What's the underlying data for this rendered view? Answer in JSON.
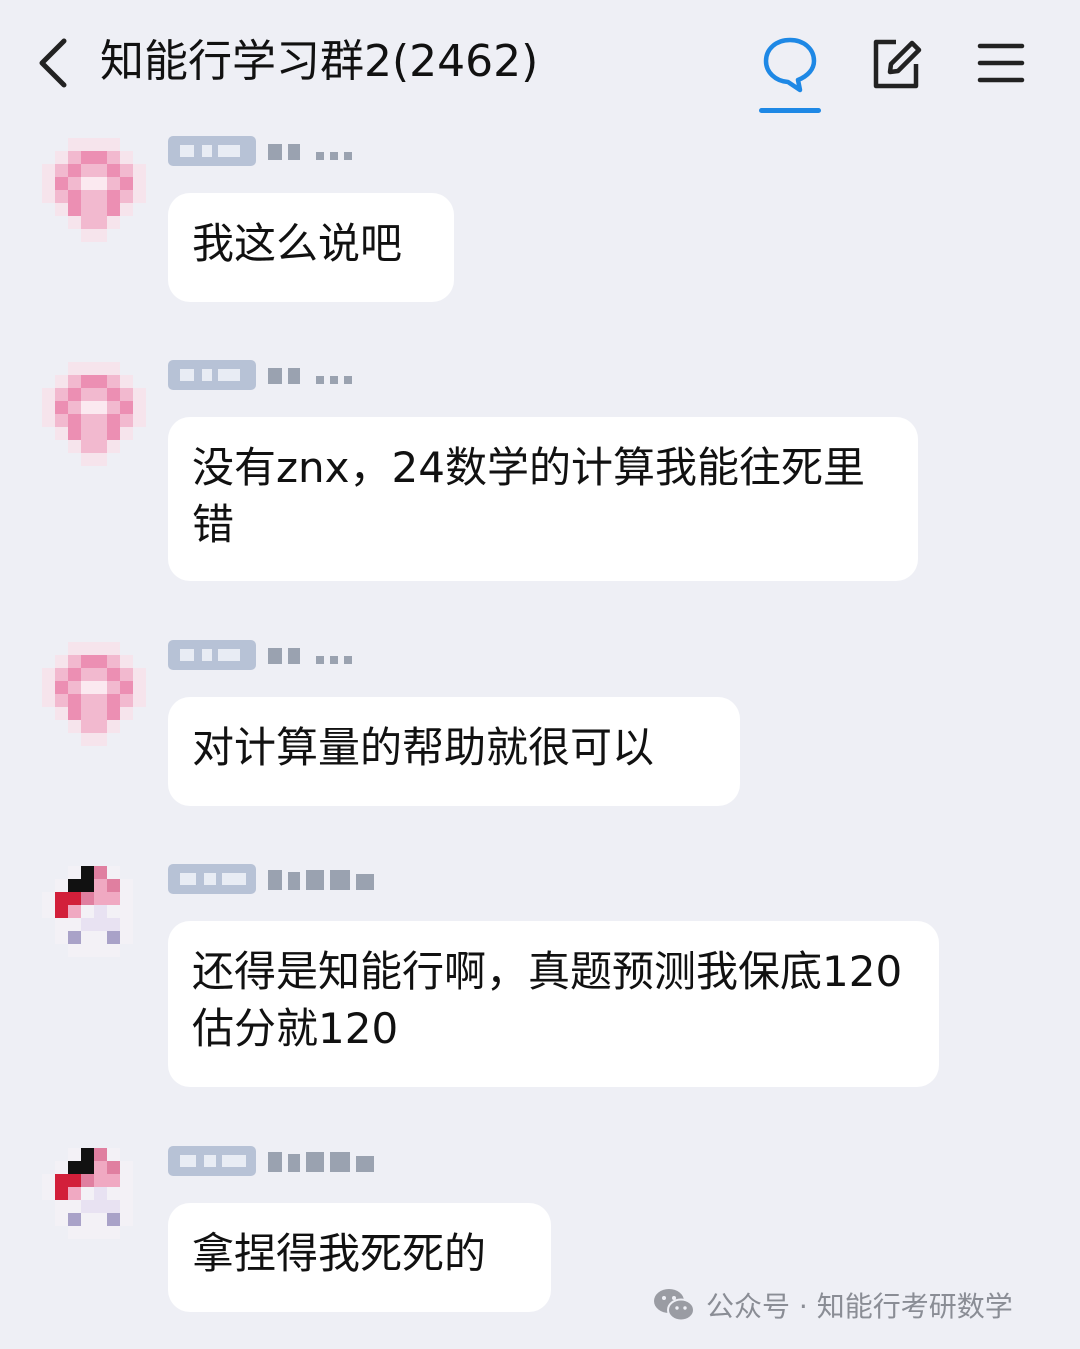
{
  "header": {
    "back_icon": "chevron-left-icon",
    "title": "知能行学习群2(2462)",
    "chat_icon": "speech-bubble-icon",
    "edit_icon": "edit-icon",
    "menu_icon": "hamburger-menu-icon",
    "accent_color": "#1e88e5"
  },
  "messages": [
    {
      "text": "我这么说吧"
    },
    {
      "text": "没有znx，24数学的计算我能往死里错"
    },
    {
      "text": "对计算量的帮助就很可以"
    },
    {
      "text": "还得是知能行啊，真题预测我保底120估分就120"
    },
    {
      "text": "拿捏得我死死的"
    }
  ],
  "watermark": {
    "icon": "wechat-icon",
    "text": "公众号 · 知能行考研数学"
  }
}
